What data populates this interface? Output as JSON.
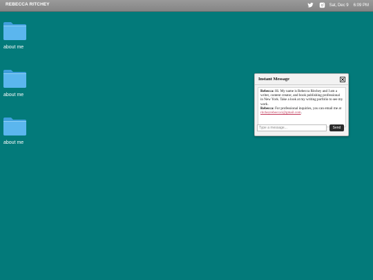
{
  "topbar": {
    "brand": "REBECCA RITCHEY",
    "date": "Sat, Dec 9",
    "time": "6:09 PM",
    "icons": [
      "twitter-icon",
      "instagram-icon"
    ]
  },
  "desktop": {
    "icons": [
      {
        "label": "about me",
        "icon": "folder-icon"
      },
      {
        "label": "about me",
        "icon": "folder-icon"
      },
      {
        "label": "about me",
        "icon": "folder-icon"
      }
    ],
    "background_color": "#037a7a",
    "folder_color": "#5bb6ee"
  },
  "im": {
    "title": "Instant Message",
    "messages": [
      {
        "sender": "Rebecca:",
        "text": " Hi. My name is Rebecca Ritchey and I am a writer, content creator, and book publishing professional in New York. Take a look at my writing porfolio to see my work."
      },
      {
        "sender": "Rebecca:",
        "text": " For professional inquiries, you can email me at ",
        "link": "ritcheyrebecca1@gmail.com",
        "after": "."
      }
    ],
    "input_placeholder": "Type a message...",
    "send_label": "Send"
  }
}
